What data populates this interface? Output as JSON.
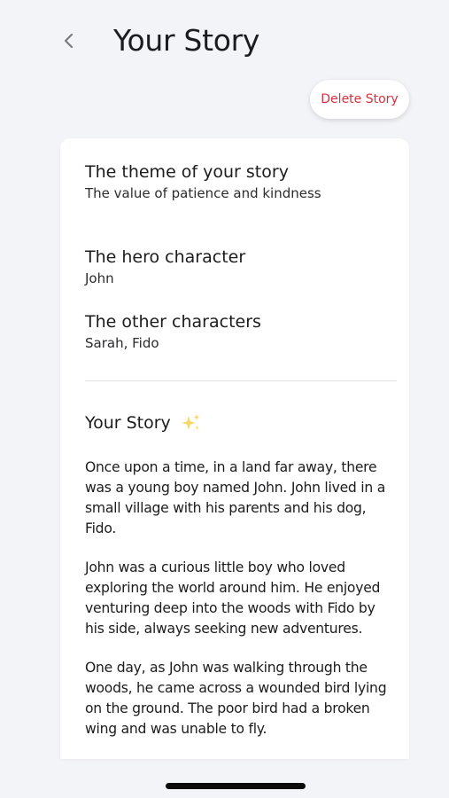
{
  "header": {
    "title": "Your Story",
    "back_icon": "chevron-left-icon"
  },
  "actions": {
    "delete_label": "Delete Story",
    "delete_color": "#d9303e"
  },
  "details": {
    "theme": {
      "title": "The theme of your story",
      "value": "The value of patience and kindness"
    },
    "hero": {
      "title": "The hero character",
      "value": "John"
    },
    "others": {
      "title": "The other characters",
      "value": "Sarah, Fido"
    }
  },
  "story": {
    "heading": "Your Story",
    "heading_icon": "sparkles-icon",
    "paragraphs": [
      "Once upon a time, in a land far away, there was a young boy named John. John lived in a small village with his parents and his dog, Fido.",
      "John was a curious little boy who loved exploring the world around him. He enjoyed venturing deep into the woods with Fido by his side, always seeking new adventures.",
      "One day, as John was walking through the woods, he came across a wounded bird lying on the ground. The poor bird had a broken wing and was unable to fly."
    ]
  }
}
